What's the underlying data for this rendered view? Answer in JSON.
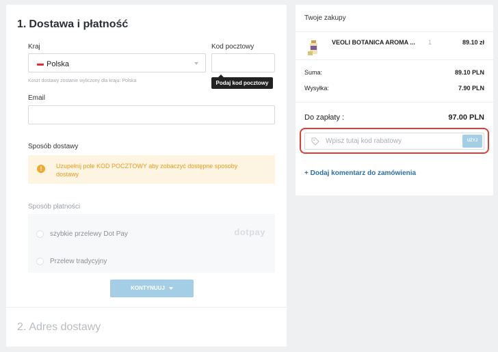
{
  "checkout": {
    "step1": {
      "number": "1.",
      "title": "Dostawa i płatność"
    },
    "country": {
      "label": "Kraj",
      "value": "Polska"
    },
    "postal": {
      "label": "Kod pocztowy",
      "value": "",
      "tooltip": "Podaj kod pocztowy"
    },
    "shipping_hint": "Koszt dostawy zostanie wyliczony dla kraju: Polska",
    "email": {
      "label": "Email",
      "value": ""
    },
    "delivery": {
      "label": "Sposób dostawy",
      "warning_icon": "!",
      "warning": "Uzupełnij pole KOD POCZTOWY aby zobaczyć dostępne sposoby dostawy"
    },
    "payment": {
      "label": "Sposób płatności",
      "options": [
        {
          "label": "szybkie przelewy Dot Pay",
          "logo": "dotpay"
        },
        {
          "label": "Przelew tradycyjny"
        }
      ]
    },
    "continue_label": "KONTYNUUJ",
    "step2": {
      "number": "2.",
      "title": "Adres dostawy"
    }
  },
  "summary": {
    "title": "Twoje zakupy",
    "item": {
      "name": "VEOLI BOTANICA AROMA ...",
      "qty": "1",
      "price": "89.10 zł"
    },
    "sum": {
      "label": "Suma:",
      "value": "89.10 PLN"
    },
    "shipping": {
      "label": "Wysyłka:",
      "value": "7.90 PLN"
    },
    "total": {
      "label": "Do zapłaty :",
      "value": "97.00 PLN"
    },
    "promo": {
      "placeholder": "Wpisz tutaj kod rabatowy",
      "button": "UŻYJ"
    },
    "comment_link": "+ Dodaj komentarz do zamówienia"
  },
  "colors": {
    "accent": "#2c6fa7",
    "button": "#a4cde6",
    "warning_bg": "#fdf4e1",
    "warning_text": "#e89a1e",
    "highlight": "#e23b36"
  }
}
